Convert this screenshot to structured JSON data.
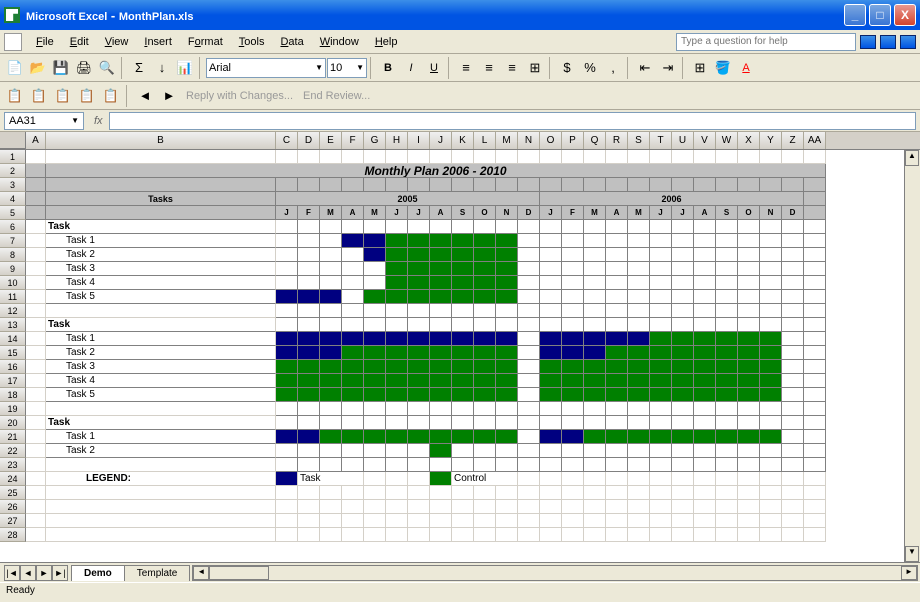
{
  "titlebar": {
    "app": "Microsoft Excel",
    "doc": "MonthPlan.xls"
  },
  "menu": [
    "File",
    "Edit",
    "View",
    "Insert",
    "Format",
    "Tools",
    "Data",
    "Window",
    "Help"
  ],
  "help_placeholder": "Type a question for help",
  "toolbar": {
    "font": "Arial",
    "size": "10"
  },
  "review": {
    "reply": "Reply with Changes...",
    "end": "End Review..."
  },
  "formula": {
    "cell": "AA31",
    "fx": "fx"
  },
  "sheet": {
    "title": "Monthly Plan 2006 - 2010",
    "tasks_header": "Tasks",
    "years": [
      "2005",
      "2006"
    ],
    "months": [
      "J",
      "F",
      "M",
      "A",
      "M",
      "J",
      "J",
      "A",
      "S",
      "O",
      "N",
      "D"
    ],
    "cols": [
      "A",
      "B",
      "C",
      "D",
      "E",
      "F",
      "G",
      "H",
      "I",
      "J",
      "K",
      "L",
      "M",
      "N",
      "O",
      "P",
      "Q",
      "R",
      "S",
      "T",
      "U",
      "V",
      "W",
      "X",
      "Y",
      "Z",
      "AA"
    ],
    "rows_shown": 28,
    "groups": [
      {
        "label": "Task",
        "tasks": [
          {
            "name": "Task 1",
            "bars": [
              {
                "s": 3,
                "e": 5,
                "c": "blue"
              },
              {
                "s": 5,
                "e": 11,
                "c": "green"
              }
            ]
          },
          {
            "name": "Task 2",
            "bars": [
              {
                "s": 4,
                "e": 6,
                "c": "blue"
              },
              {
                "s": 5,
                "e": 11,
                "c": "green"
              }
            ]
          },
          {
            "name": "Task 3",
            "bars": [
              {
                "s": 5,
                "e": 11,
                "c": "green"
              }
            ]
          },
          {
            "name": "Task 4",
            "bars": [
              {
                "s": 5,
                "e": 11,
                "c": "green"
              }
            ]
          },
          {
            "name": "Task 5",
            "bars": [
              {
                "s": 0,
                "e": 3,
                "c": "blue"
              },
              {
                "s": 4,
                "e": 11,
                "c": "green"
              }
            ]
          }
        ]
      },
      {
        "label": "Task",
        "tasks": [
          {
            "name": "Task 1",
            "bars": [
              {
                "s": 0,
                "e": 11,
                "c": "blue"
              },
              {
                "s": 12,
                "e": 17,
                "c": "blue"
              },
              {
                "s": 17,
                "e": 23,
                "c": "green"
              }
            ]
          },
          {
            "name": "Task 2",
            "bars": [
              {
                "s": 0,
                "e": 3,
                "c": "blue"
              },
              {
                "s": 3,
                "e": 11,
                "c": "green"
              },
              {
                "s": 12,
                "e": 15,
                "c": "blue"
              },
              {
                "s": 15,
                "e": 23,
                "c": "green"
              }
            ]
          },
          {
            "name": "Task 3",
            "bars": [
              {
                "s": 0,
                "e": 11,
                "c": "green"
              },
              {
                "s": 12,
                "e": 23,
                "c": "green"
              }
            ]
          },
          {
            "name": "Task 4",
            "bars": [
              {
                "s": 0,
                "e": 11,
                "c": "green"
              },
              {
                "s": 12,
                "e": 23,
                "c": "green"
              }
            ]
          },
          {
            "name": "Task 5",
            "bars": [
              {
                "s": 0,
                "e": 11,
                "c": "green"
              },
              {
                "s": 12,
                "e": 23,
                "c": "green"
              }
            ]
          }
        ]
      },
      {
        "label": "Task",
        "tasks": [
          {
            "name": "Task 1",
            "bars": [
              {
                "s": 0,
                "e": 2,
                "c": "blue"
              },
              {
                "s": 2,
                "e": 11,
                "c": "green"
              },
              {
                "s": 12,
                "e": 14,
                "c": "blue"
              },
              {
                "s": 14,
                "e": 23,
                "c": "green"
              }
            ]
          },
          {
            "name": "Task 2",
            "bars": [
              {
                "s": 7,
                "e": 8,
                "c": "green"
              }
            ]
          }
        ]
      }
    ],
    "legend": {
      "label": "LEGEND:",
      "task": "Task",
      "control": "Control"
    }
  },
  "tabs": [
    "Demo",
    "Template"
  ],
  "status": "Ready",
  "chart_data": {
    "type": "gantt",
    "title": "Monthly Plan 2006 - 2010",
    "time_axis": {
      "years": [
        2005,
        2006
      ],
      "months_per_year": 12
    },
    "legend": {
      "blue": "Task",
      "green": "Control"
    },
    "series": [
      {
        "group": 1,
        "task": "Task 1",
        "segments": [
          {
            "start": "2005-04",
            "end": "2005-06",
            "type": "Task"
          },
          {
            "start": "2005-06",
            "end": "2005-12",
            "type": "Control"
          }
        ]
      },
      {
        "group": 1,
        "task": "Task 2",
        "segments": [
          {
            "start": "2005-05",
            "end": "2005-07",
            "type": "Task"
          },
          {
            "start": "2005-06",
            "end": "2005-12",
            "type": "Control"
          }
        ]
      },
      {
        "group": 1,
        "task": "Task 3",
        "segments": [
          {
            "start": "2005-06",
            "end": "2005-12",
            "type": "Control"
          }
        ]
      },
      {
        "group": 1,
        "task": "Task 4",
        "segments": [
          {
            "start": "2005-06",
            "end": "2005-12",
            "type": "Control"
          }
        ]
      },
      {
        "group": 1,
        "task": "Task 5",
        "segments": [
          {
            "start": "2005-01",
            "end": "2005-04",
            "type": "Task"
          },
          {
            "start": "2005-05",
            "end": "2005-12",
            "type": "Control"
          }
        ]
      },
      {
        "group": 2,
        "task": "Task 1",
        "segments": [
          {
            "start": "2005-01",
            "end": "2005-12",
            "type": "Task"
          },
          {
            "start": "2006-01",
            "end": "2006-06",
            "type": "Task"
          },
          {
            "start": "2006-06",
            "end": "2006-12",
            "type": "Control"
          }
        ]
      },
      {
        "group": 2,
        "task": "Task 2",
        "segments": [
          {
            "start": "2005-01",
            "end": "2005-04",
            "type": "Task"
          },
          {
            "start": "2005-04",
            "end": "2005-12",
            "type": "Control"
          },
          {
            "start": "2006-01",
            "end": "2006-04",
            "type": "Task"
          },
          {
            "start": "2006-04",
            "end": "2006-12",
            "type": "Control"
          }
        ]
      },
      {
        "group": 2,
        "task": "Task 3",
        "segments": [
          {
            "start": "2005-01",
            "end": "2005-12",
            "type": "Control"
          },
          {
            "start": "2006-01",
            "end": "2006-12",
            "type": "Control"
          }
        ]
      },
      {
        "group": 2,
        "task": "Task 4",
        "segments": [
          {
            "start": "2005-01",
            "end": "2005-12",
            "type": "Control"
          },
          {
            "start": "2006-01",
            "end": "2006-12",
            "type": "Control"
          }
        ]
      },
      {
        "group": 2,
        "task": "Task 5",
        "segments": [
          {
            "start": "2005-01",
            "end": "2005-12",
            "type": "Control"
          },
          {
            "start": "2006-01",
            "end": "2006-12",
            "type": "Control"
          }
        ]
      },
      {
        "group": 3,
        "task": "Task 1",
        "segments": [
          {
            "start": "2005-01",
            "end": "2005-03",
            "type": "Task"
          },
          {
            "start": "2005-03",
            "end": "2005-12",
            "type": "Control"
          },
          {
            "start": "2006-01",
            "end": "2006-03",
            "type": "Task"
          },
          {
            "start": "2006-03",
            "end": "2006-12",
            "type": "Control"
          }
        ]
      },
      {
        "group": 3,
        "task": "Task 2",
        "segments": [
          {
            "start": "2005-08",
            "end": "2005-09",
            "type": "Control"
          }
        ]
      }
    ]
  }
}
